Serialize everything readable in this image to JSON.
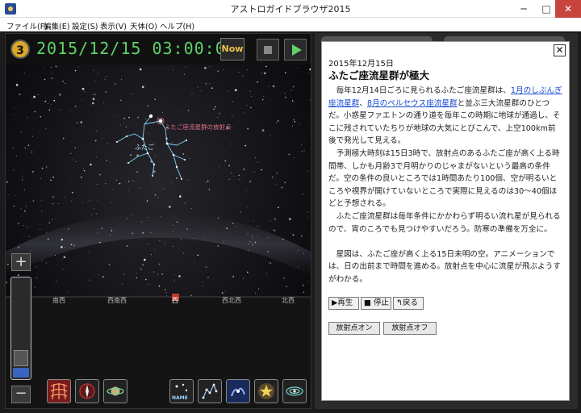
{
  "window": {
    "title": "アストロガイドブラウザ2015",
    "minimize": "─",
    "maximize": "□",
    "close": "✕"
  },
  "menu": [
    "ファイル(F)",
    "編集(E)",
    "設定(S)",
    "表示(V)",
    "天体(O)",
    "ヘルプ(H)"
  ],
  "sky": {
    "badge": "3",
    "datetime": "2015/12/15  03:00:00",
    "now_label": "Now",
    "zoom_plus": "+",
    "zoom_minus": "−",
    "zoom_level": 0.1,
    "radiant_label": "ふたご座流星群の放射点",
    "constellation_label": "ふたご",
    "directions": [
      "南西",
      "西南西",
      "西",
      "西北西",
      "北西"
    ],
    "name_tool_label": "NAME"
  },
  "info": {
    "close": "✕",
    "date": "2015年12月15日",
    "title": "ふたご座流星群が極大",
    "p1_a": "毎年12月14日ごろに見られるふたご座流星群は、",
    "p1_link1": "1月のしぶんぎ座流星群",
    "p1_b": "、",
    "p1_link2": "8月のペルセウス座流星群",
    "p1_c": "と並ぶ三大流星群のひとつだ。小惑星ファエトンの通り道を毎年この時期に地球が通過し、そこに残されていたちりが地球の大気にとびこんで、上空100km前後で発光して見える。",
    "p2": "予測極大時刻は15日3時で、放射点のあるふたご座が高く上る時間帯、しかも月齢3で月明かりのじゃまがないという最高の条件だ。空の条件の良いところでは1時間あたり100個、空が明るいところや視界が開けていないところで実際に見えるのは30〜40個ほどと予想される。",
    "p3": "ふたご座流星群は毎年条件にかかわらず明るい流れ星が見られるので、宵のころでも見つけやすいだろう。防寒の準備を万全に。",
    "p4": "星図は、ふたご座が高く上る15日未明の空。アニメーションでは、日の出前まで時間を進める。放射点を中心に流星が飛ぶようすがわかる。",
    "buttons": {
      "play": "▶再生",
      "stop": "■ 停止",
      "back": "↰戻る"
    },
    "radiant_on": "放射点オン",
    "radiant_off": "放射点オフ"
  },
  "colors": {
    "date_green": "#5fd26b",
    "link_blue": "#1a4bd0",
    "radiant_pink": "#e0708a",
    "constellation_line": "#7fd6ff"
  }
}
